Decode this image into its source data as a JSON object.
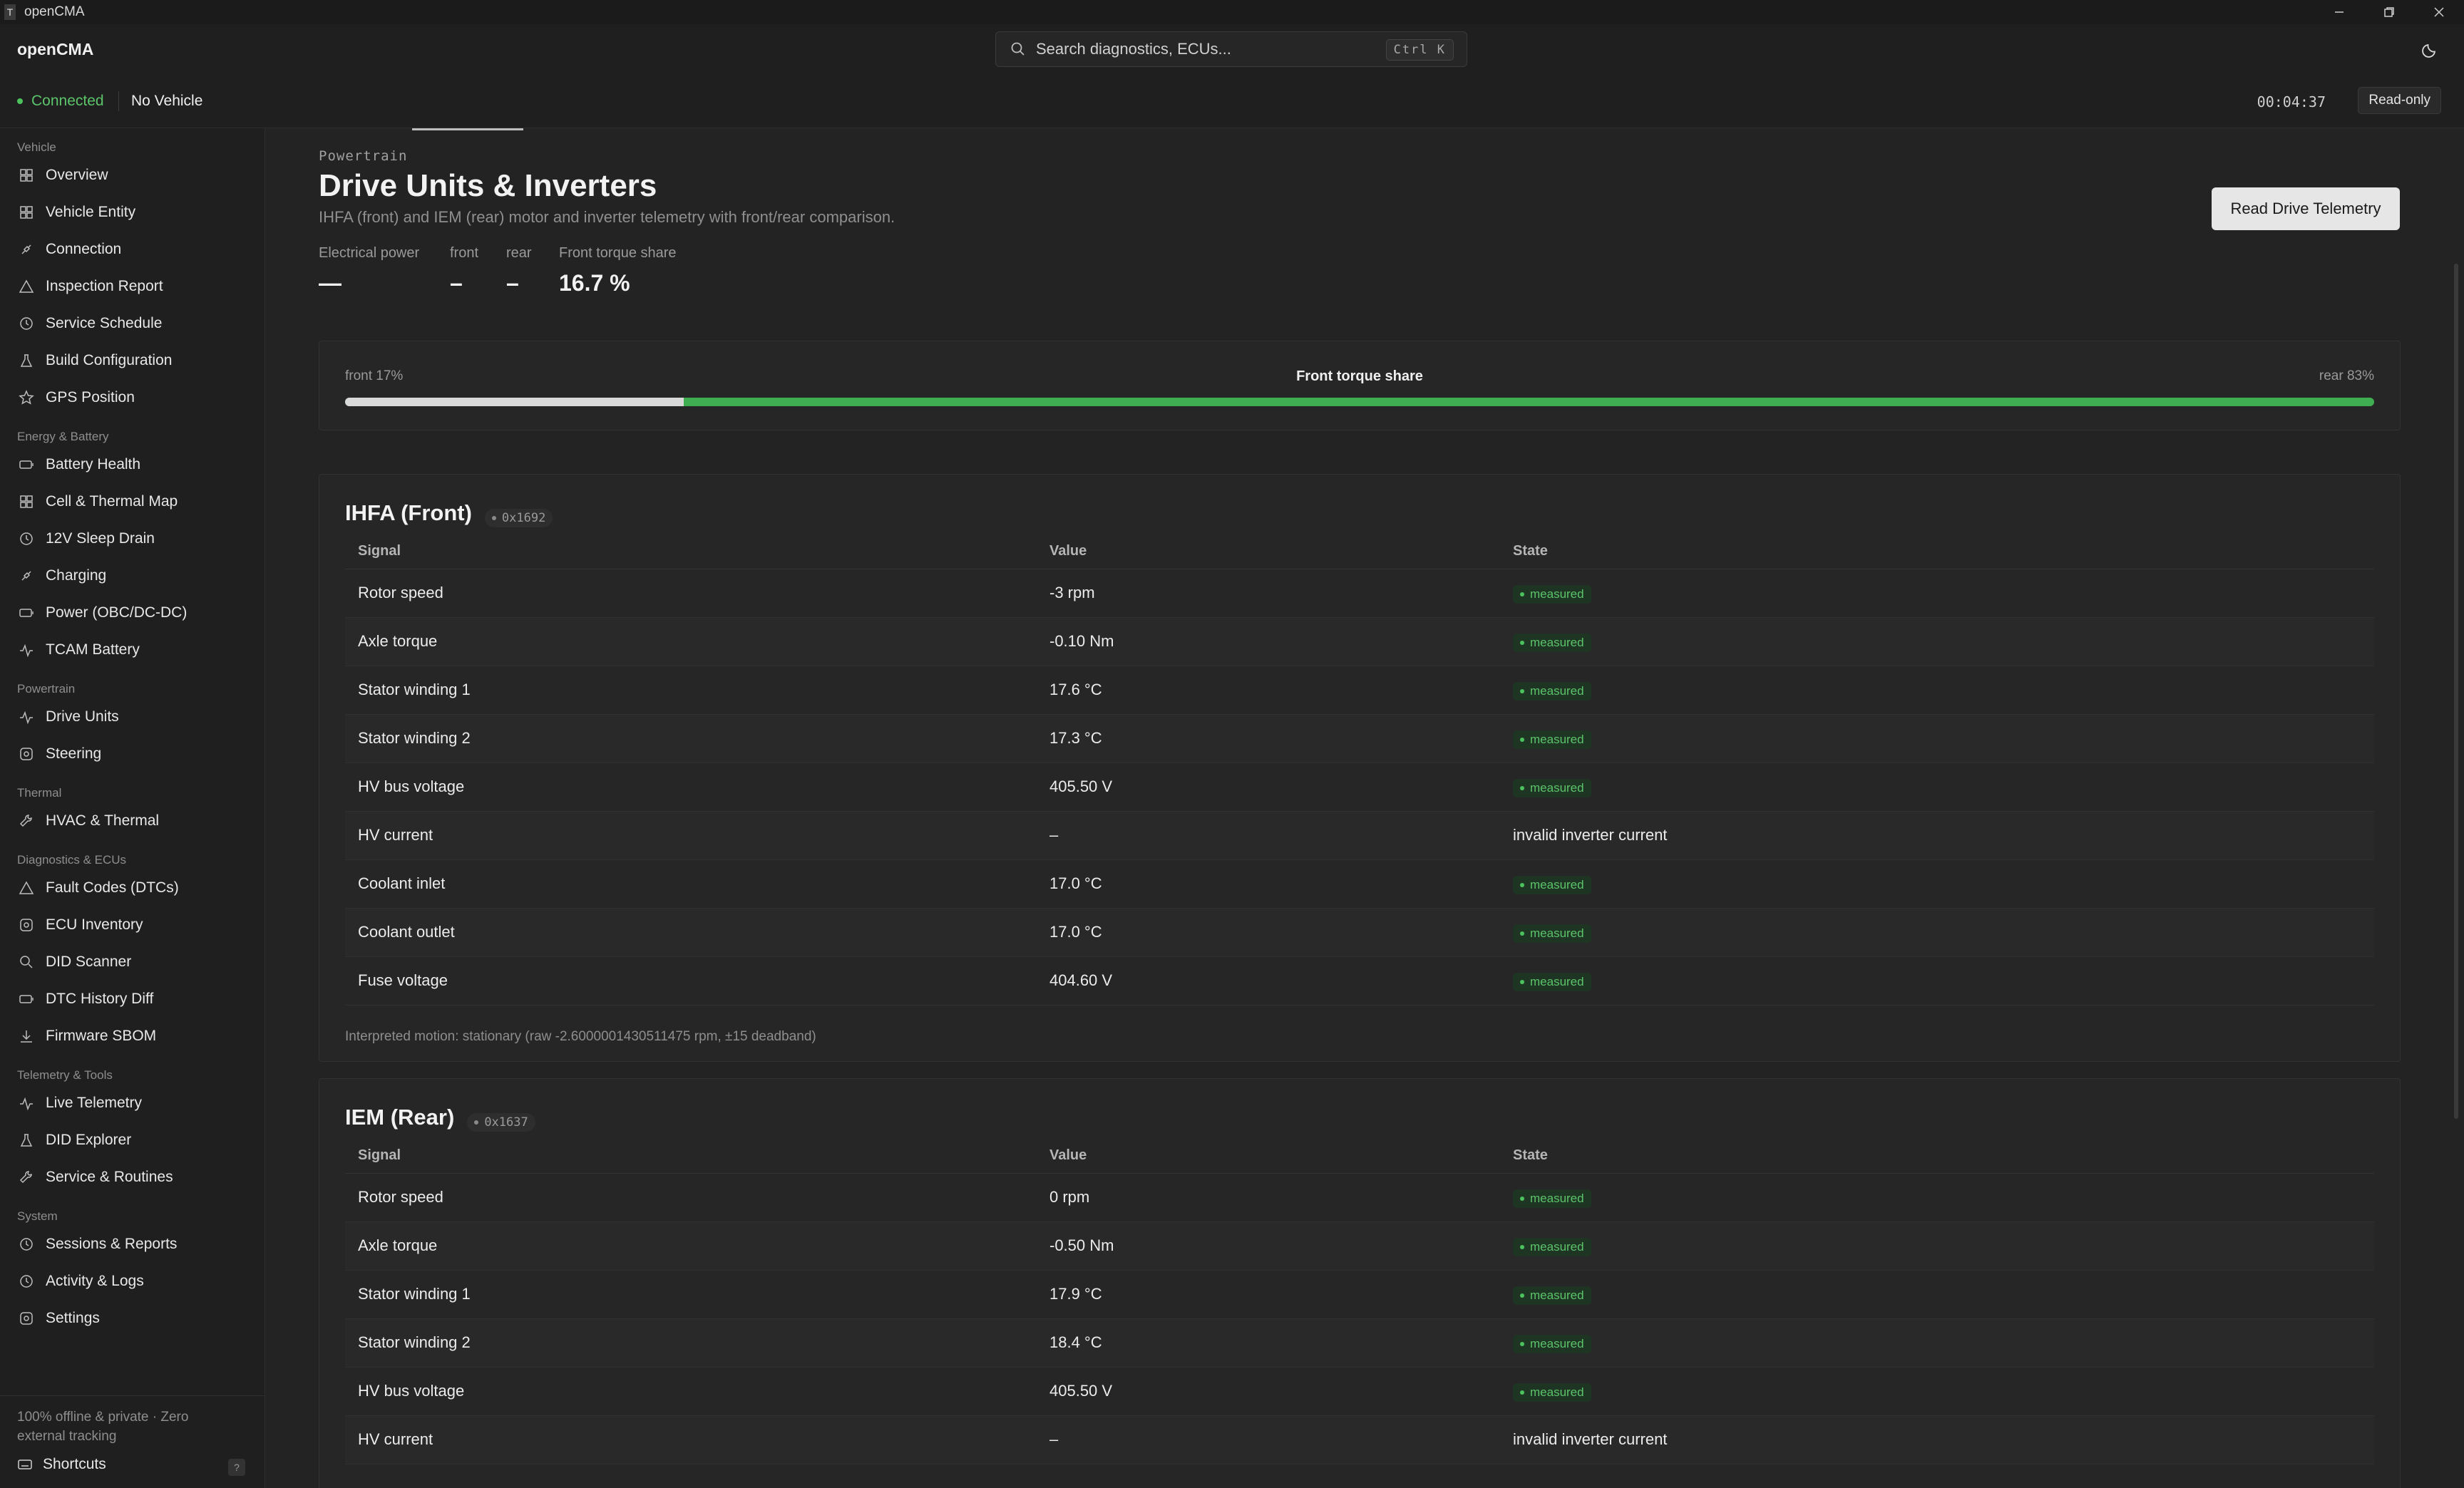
{
  "window": {
    "title": "openCMA",
    "app_icon": "T"
  },
  "header": {
    "brand": "openCMA",
    "search_placeholder": "Search diagnostics, ECUs...",
    "search_shortcut": "Ctrl K"
  },
  "status": {
    "connection": "Connected",
    "vehicle": "No Vehicle",
    "timer": "00:04:37",
    "mode": "Read-only",
    "accent_color": "#4cc25c"
  },
  "sidebar": {
    "groups": [
      {
        "label": "Vehicle",
        "items": [
          {
            "label": "Overview",
            "icon": "grid-icon"
          },
          {
            "label": "Vehicle Entity",
            "icon": "grid-icon"
          },
          {
            "label": "Connection",
            "icon": "plug-icon"
          },
          {
            "label": "Inspection Report",
            "icon": "triangle-icon"
          },
          {
            "label": "Service Schedule",
            "icon": "clock-icon"
          },
          {
            "label": "Build Configuration",
            "icon": "flask-icon"
          },
          {
            "label": "GPS Position",
            "icon": "star-icon"
          }
        ]
      },
      {
        "label": "Energy & Battery",
        "items": [
          {
            "label": "Battery Health",
            "icon": "battery-icon"
          },
          {
            "label": "Cell & Thermal Map",
            "icon": "grid-icon"
          },
          {
            "label": "12V Sleep Drain",
            "icon": "clock-icon"
          },
          {
            "label": "Charging",
            "icon": "plug-icon"
          },
          {
            "label": "Power (OBC/DC-DC)",
            "icon": "battery-icon"
          },
          {
            "label": "TCAM Battery",
            "icon": "pulse-icon"
          }
        ]
      },
      {
        "label": "Powertrain",
        "items": [
          {
            "label": "Drive Units",
            "icon": "pulse-icon"
          },
          {
            "label": "Steering",
            "icon": "gear-icon"
          }
        ]
      },
      {
        "label": "Thermal",
        "items": [
          {
            "label": "HVAC & Thermal",
            "icon": "wrench-icon"
          }
        ]
      },
      {
        "label": "Diagnostics & ECUs",
        "items": [
          {
            "label": "Fault Codes (DTCs)",
            "icon": "triangle-icon"
          },
          {
            "label": "ECU Inventory",
            "icon": "gear-icon"
          },
          {
            "label": "DID Scanner",
            "icon": "search-icon"
          },
          {
            "label": "DTC History Diff",
            "icon": "battery-icon"
          },
          {
            "label": "Firmware SBOM",
            "icon": "download-icon"
          }
        ]
      },
      {
        "label": "Telemetry & Tools",
        "items": [
          {
            "label": "Live Telemetry",
            "icon": "pulse-icon"
          },
          {
            "label": "DID Explorer",
            "icon": "flask-icon"
          },
          {
            "label": "Service & Routines",
            "icon": "wrench-icon"
          }
        ]
      },
      {
        "label": "System",
        "items": [
          {
            "label": "Sessions & Reports",
            "icon": "clock-icon"
          },
          {
            "label": "Activity & Logs",
            "icon": "clock-icon"
          },
          {
            "label": "Settings",
            "icon": "gear-icon"
          }
        ]
      }
    ],
    "footer_note": "100% offline & private · Zero external tracking",
    "shortcuts_label": "Shortcuts",
    "shortcuts_key": "?"
  },
  "page": {
    "eyebrow": "Powertrain",
    "title": "Drive Units & Inverters",
    "subtitle": "IHFA (front) and IEM (rear) motor and inverter telemetry with front/rear comparison.",
    "read_button": "Read Drive Telemetry",
    "stats": [
      {
        "label": "Electrical power",
        "value": "—"
      },
      {
        "label": "front",
        "value": "–"
      },
      {
        "label": "rear",
        "value": "–"
      },
      {
        "label": "Front torque share",
        "value": "16.7 %"
      }
    ],
    "torque_bar": {
      "left_label": "front 17%",
      "center_label": "Front torque share",
      "right_label": "rear 83%",
      "front_fraction": 0.167
    }
  },
  "table_headers": {
    "signal": "Signal",
    "value": "Value",
    "state": "State"
  },
  "front_unit": {
    "name": "IHFA (Front)",
    "address": "0x1692",
    "rows": [
      {
        "signal": "Rotor speed",
        "value": "-3 rpm",
        "state": "measured",
        "badge": true
      },
      {
        "signal": "Axle torque",
        "value": "-0.10 Nm",
        "state": "measured",
        "badge": true
      },
      {
        "signal": "Stator winding 1",
        "value": "17.6 °C",
        "state": "measured",
        "badge": true
      },
      {
        "signal": "Stator winding 2",
        "value": "17.3 °C",
        "state": "measured",
        "badge": true
      },
      {
        "signal": "HV bus voltage",
        "value": "405.50 V",
        "state": "measured",
        "badge": true
      },
      {
        "signal": "HV current",
        "value": "–",
        "state": "invalid inverter current",
        "badge": false
      },
      {
        "signal": "Coolant inlet",
        "value": "17.0 °C",
        "state": "measured",
        "badge": true
      },
      {
        "signal": "Coolant outlet",
        "value": "17.0 °C",
        "state": "measured",
        "badge": true
      },
      {
        "signal": "Fuse voltage",
        "value": "404.60 V",
        "state": "measured",
        "badge": true
      }
    ],
    "interpretation": "Interpreted motion: stationary (raw -2.6000001430511475 rpm, ±15 deadband)"
  },
  "rear_unit": {
    "name": "IEM (Rear)",
    "address": "0x1637",
    "rows": [
      {
        "signal": "Rotor speed",
        "value": "0 rpm",
        "state": "measured",
        "badge": true
      },
      {
        "signal": "Axle torque",
        "value": "-0.50 Nm",
        "state": "measured",
        "badge": true
      },
      {
        "signal": "Stator winding 1",
        "value": "17.9 °C",
        "state": "measured",
        "badge": true
      },
      {
        "signal": "Stator winding 2",
        "value": "18.4 °C",
        "state": "measured",
        "badge": true
      },
      {
        "signal": "HV bus voltage",
        "value": "405.50 V",
        "state": "measured",
        "badge": true
      },
      {
        "signal": "HV current",
        "value": "–",
        "state": "invalid inverter current",
        "badge": false
      }
    ]
  }
}
